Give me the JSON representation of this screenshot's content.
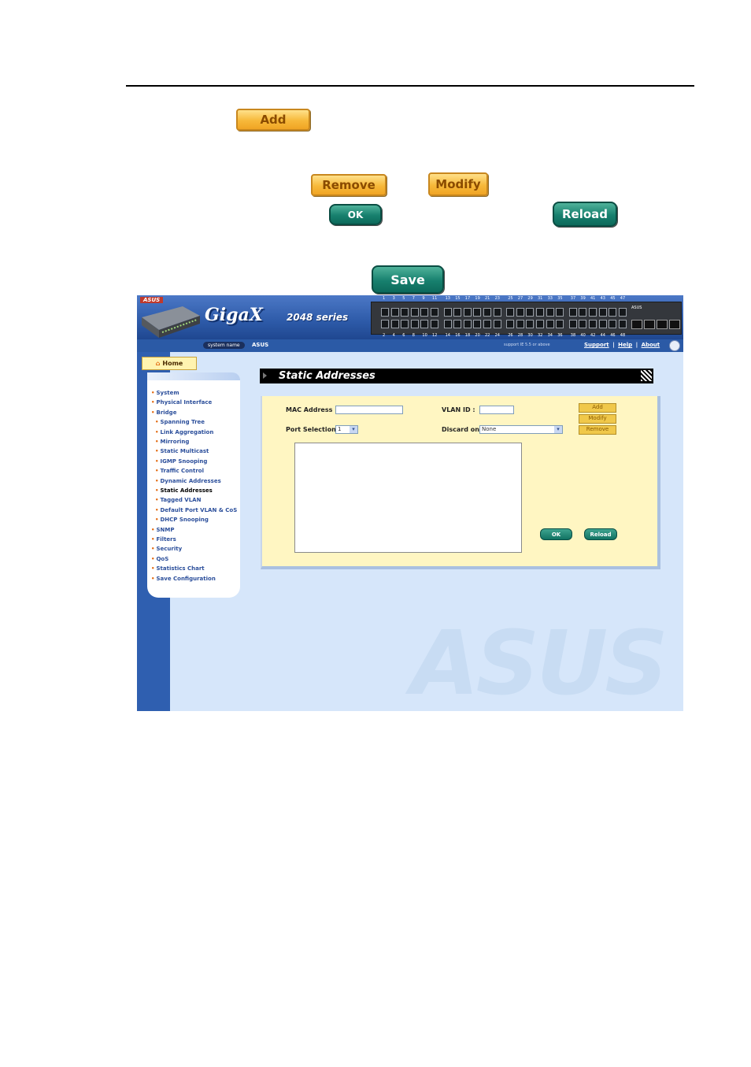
{
  "legend": {
    "add": "Add",
    "remove": "Remove",
    "modify": "Modify",
    "ok": "OK",
    "reload": "Reload",
    "save": "Save"
  },
  "header": {
    "brand": "ASUS",
    "product_name": "GigaX",
    "product_series": "2048 series",
    "system_name_label": "system name",
    "system_name_value": "ASUS",
    "support_text": "support IE 5.5 or above",
    "links": [
      "Support",
      "Help",
      "About"
    ],
    "port_numbers_top": [
      "1",
      "3",
      "5",
      "7",
      "9",
      "11",
      "13",
      "15",
      "17",
      "19",
      "21",
      "23",
      "25",
      "27",
      "29",
      "31",
      "33",
      "35",
      "37",
      "39",
      "41",
      "43",
      "45",
      "47"
    ],
    "port_numbers_bottom": [
      "2",
      "4",
      "6",
      "8",
      "10",
      "12",
      "14",
      "16",
      "18",
      "20",
      "22",
      "24",
      "26",
      "28",
      "30",
      "32",
      "34",
      "36",
      "38",
      "40",
      "42",
      "44",
      "46",
      "48"
    ]
  },
  "nav": {
    "home": "Home",
    "items": [
      {
        "label": "System",
        "level": 0,
        "active": false
      },
      {
        "label": "Physical Interface",
        "level": 0,
        "active": false
      },
      {
        "label": "Bridge",
        "level": 0,
        "active": false
      },
      {
        "label": "Spanning Tree",
        "level": 1,
        "active": false
      },
      {
        "label": "Link Aggregation",
        "level": 1,
        "active": false
      },
      {
        "label": "Mirroring",
        "level": 1,
        "active": false
      },
      {
        "label": "Static Multicast",
        "level": 1,
        "active": false
      },
      {
        "label": "IGMP Snooping",
        "level": 1,
        "active": false
      },
      {
        "label": "Traffic Control",
        "level": 1,
        "active": false
      },
      {
        "label": "Dynamic Addresses",
        "level": 1,
        "active": false
      },
      {
        "label": "Static Addresses",
        "level": 1,
        "active": true
      },
      {
        "label": "Tagged VLAN",
        "level": 1,
        "active": false
      },
      {
        "label": "Default Port VLAN & CoS",
        "level": 1,
        "active": false
      },
      {
        "label": "DHCP Snooping",
        "level": 1,
        "active": false
      },
      {
        "label": "SNMP",
        "level": 0,
        "active": false
      },
      {
        "label": "Filters",
        "level": 0,
        "active": false
      },
      {
        "label": "Security",
        "level": 0,
        "active": false
      },
      {
        "label": "QoS",
        "level": 0,
        "active": false
      },
      {
        "label": "Statistics Chart",
        "level": 0,
        "active": false
      },
      {
        "label": "Save Configuration",
        "level": 0,
        "active": false
      }
    ]
  },
  "page": {
    "title": "Static Addresses",
    "mac_label": "MAC Address :",
    "mac_value": "",
    "vlan_label": "VLAN ID :",
    "vlan_value": "",
    "port_label": "Port Selection :",
    "port_value": "1",
    "discard_label": "Discard on:",
    "discard_value": "None",
    "add_btn": "Add",
    "modify_btn": "Modify",
    "remove_btn": "Remove",
    "ok_btn": "OK",
    "reload_btn": "Reload",
    "watermark": "ASUS"
  },
  "colors": {
    "accent_orange": "#e36b13",
    "nav_blue": "#2c4f9b",
    "panel_yellow": "#fff6c2",
    "teal_button": "#17806e"
  }
}
